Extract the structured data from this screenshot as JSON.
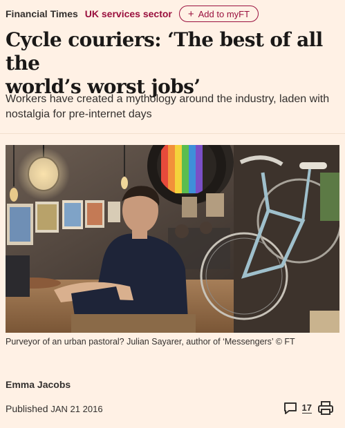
{
  "header": {
    "brand": "Financial Times",
    "section": "UK services sector",
    "myft_label": "Add to myFT",
    "myft_icon": "plus-icon"
  },
  "article": {
    "headline_line1": "Cycle couriers: ‘The best of all the",
    "headline_line2": "world’s worst jobs’",
    "standfirst": "Workers have created a mythology around the industry, laden with nostalgia for pre-internet days",
    "image_alt": "Man seated in a café beside a bicycle",
    "caption": "Purveyor of an urban pastoral? Julian Sayarer, author of ‘Messengers’ © FT",
    "author": "Emma Jacobs",
    "published_label": "Published",
    "published_date": "JAN 21 2016"
  },
  "actions": {
    "comment_count": "17",
    "comment_icon": "comment-icon",
    "print_icon": "print-icon"
  },
  "colors": {
    "background": "#fff1e5",
    "accent": "#990f3d",
    "text": "#33302e"
  }
}
